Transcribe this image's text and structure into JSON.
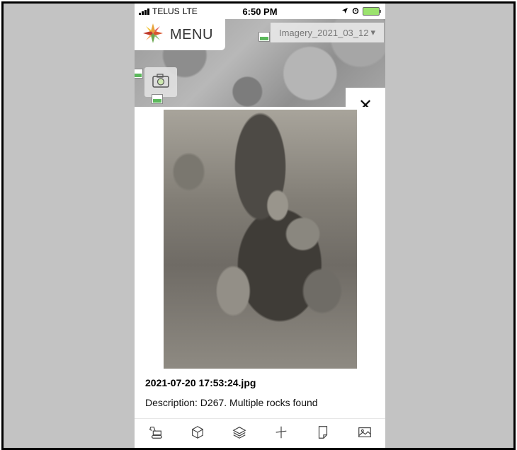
{
  "status_bar": {
    "carrier": "TELUS",
    "network": "LTE",
    "time": "6:50 PM"
  },
  "map": {
    "menu_label": "MENU",
    "imagery_label": "Imagery_2021_03_12",
    "imagery_caret": "▾",
    "close_symbol": "✕"
  },
  "photo_panel": {
    "filename": "2021-07-20 17:53:24.jpg",
    "description": "Description: D267. Multiple rocks found"
  },
  "toolbar": {
    "items": [
      {
        "icon": "excavator-icon"
      },
      {
        "icon": "cube-icon"
      },
      {
        "icon": "layers-icon"
      },
      {
        "icon": "measure-icon"
      },
      {
        "icon": "document-icon"
      },
      {
        "icon": "image-icon"
      }
    ]
  },
  "colors": {
    "frame_background": "#c3c3c3",
    "battery_fill": "#9be36e",
    "thumbnail_accent": "#5cb85c"
  }
}
